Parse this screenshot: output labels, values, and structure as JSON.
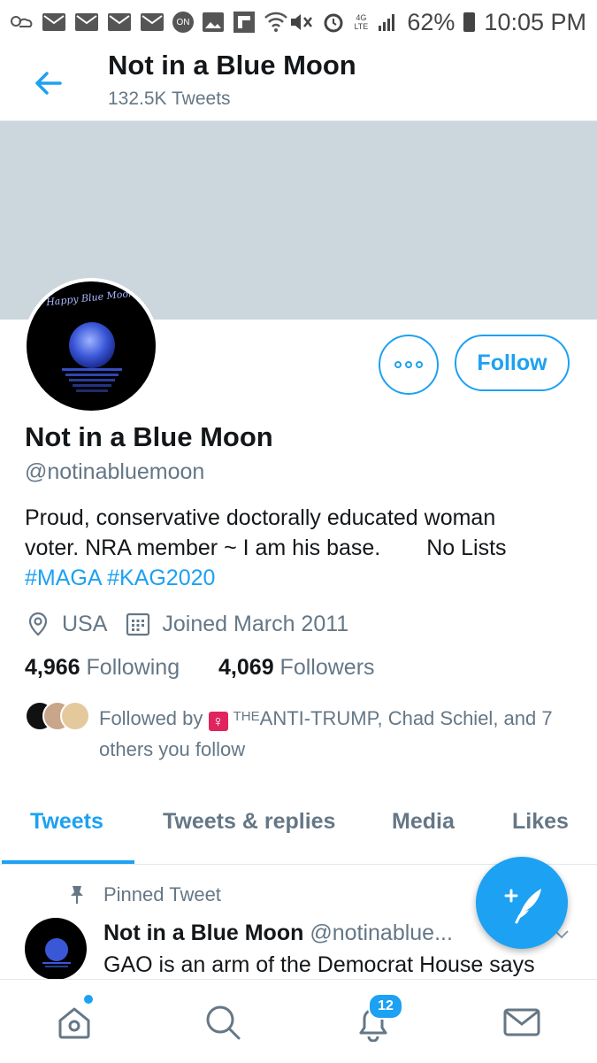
{
  "status_bar": {
    "battery": "62%",
    "time": "10:05 PM",
    "network": "4G LTE",
    "icons": [
      "weather-icon",
      "mail-icon",
      "mail-icon",
      "mail-icon",
      "mail-icon",
      "on-icon",
      "image-icon",
      "flipboard-icon",
      "wifi-icon",
      "mute-icon",
      "alarm-icon",
      "signal-icon",
      "battery-icon"
    ]
  },
  "header": {
    "title": "Not in a Blue Moon",
    "tweet_count": "132.5K Tweets"
  },
  "profile": {
    "avatar_text": "Happy Blue Moon",
    "follow_label": "Follow",
    "name": "Not in a Blue Moon",
    "handle": "@notinabluemoon",
    "bio_line1": "Proud, conservative doctorally educated woman",
    "bio_line2a": "voter. NRA member ~ I am his base.",
    "bio_line2b": "No Lists",
    "hashtags": [
      "#MAGA",
      "#KAG2020"
    ],
    "location": "USA",
    "joined": "Joined March 2011",
    "following_count": "4,966",
    "following_label": "Following",
    "followers_count": "4,069",
    "followers_label": "Followers",
    "followed_by_prefix": "Followed by",
    "followed_by_badge": "THE",
    "followed_by_name": "ANTI-TRUMP",
    "followed_by_rest": ", Chad Schiel, and 7",
    "followed_by_line2": "others you follow"
  },
  "tabs": [
    {
      "label": "Tweets",
      "active": true
    },
    {
      "label": "Tweets & replies",
      "active": false
    },
    {
      "label": "Media",
      "active": false
    },
    {
      "label": "Likes",
      "active": false
    }
  ],
  "pinned_tweet": {
    "pinned_label": "Pinned Tweet",
    "author": "Not in a Blue Moon",
    "handle": "@notinablue...",
    "text": "GAO is an arm of the Democrat House  says"
  },
  "bottom_nav": {
    "notifications_badge": "12",
    "items": [
      "home-icon",
      "search-icon",
      "notifications-icon",
      "messages-icon"
    ]
  },
  "colors": {
    "accent": "#1da1f2",
    "banner": "#ccd6dd",
    "secondary_text": "#657786"
  }
}
